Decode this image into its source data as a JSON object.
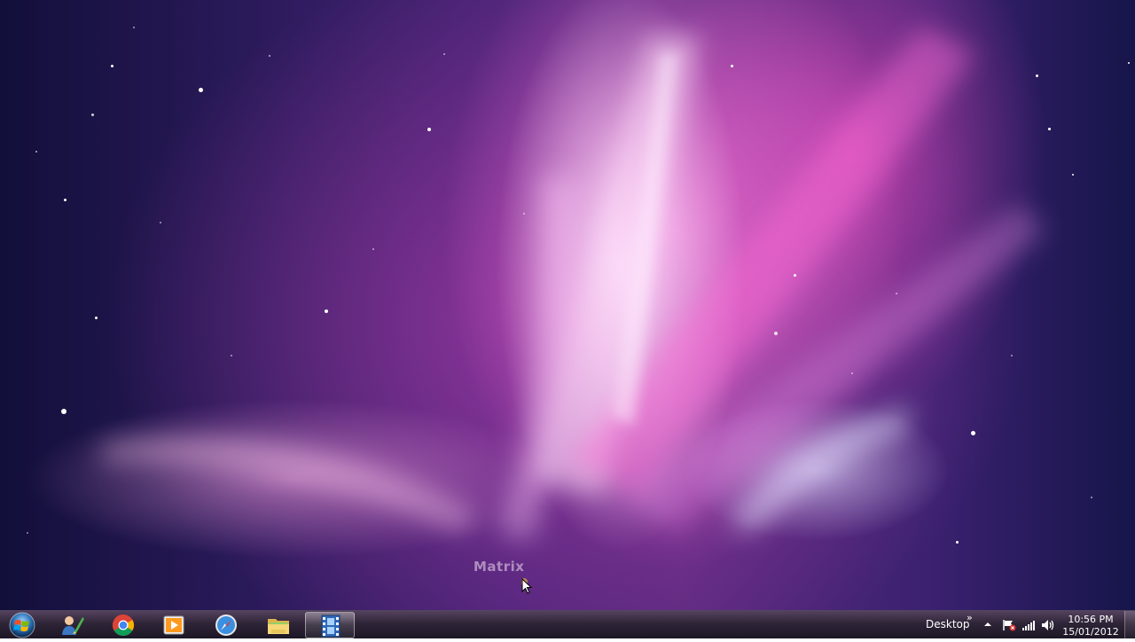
{
  "desktop": {
    "gadget_label": "Matrix"
  },
  "taskbar": {
    "start_icon": "windows-orb-icon",
    "pinned": [
      {
        "name": "user-accounts-icon",
        "active": false
      },
      {
        "name": "chrome-icon",
        "active": false
      },
      {
        "name": "media-player-icon",
        "active": false
      },
      {
        "name": "safari-icon",
        "active": false
      },
      {
        "name": "file-explorer-icon",
        "active": false
      },
      {
        "name": "video-editor-icon",
        "active": true
      }
    ],
    "desktop_toolbar_label": "Desktop",
    "toolbar_chevron": "»",
    "tray_icons": [
      "show-hidden-icons-arrow",
      "action-center-flag-icon",
      "network-signal-icon",
      "volume-icon"
    ],
    "clock": {
      "time": "10:56 PM",
      "date": "15/01/2012"
    }
  },
  "colors": {
    "wallpaper_magenta": "#ff5ad2",
    "wallpaper_deep_blue": "#120f3a",
    "taskbar": "#231a2d"
  }
}
